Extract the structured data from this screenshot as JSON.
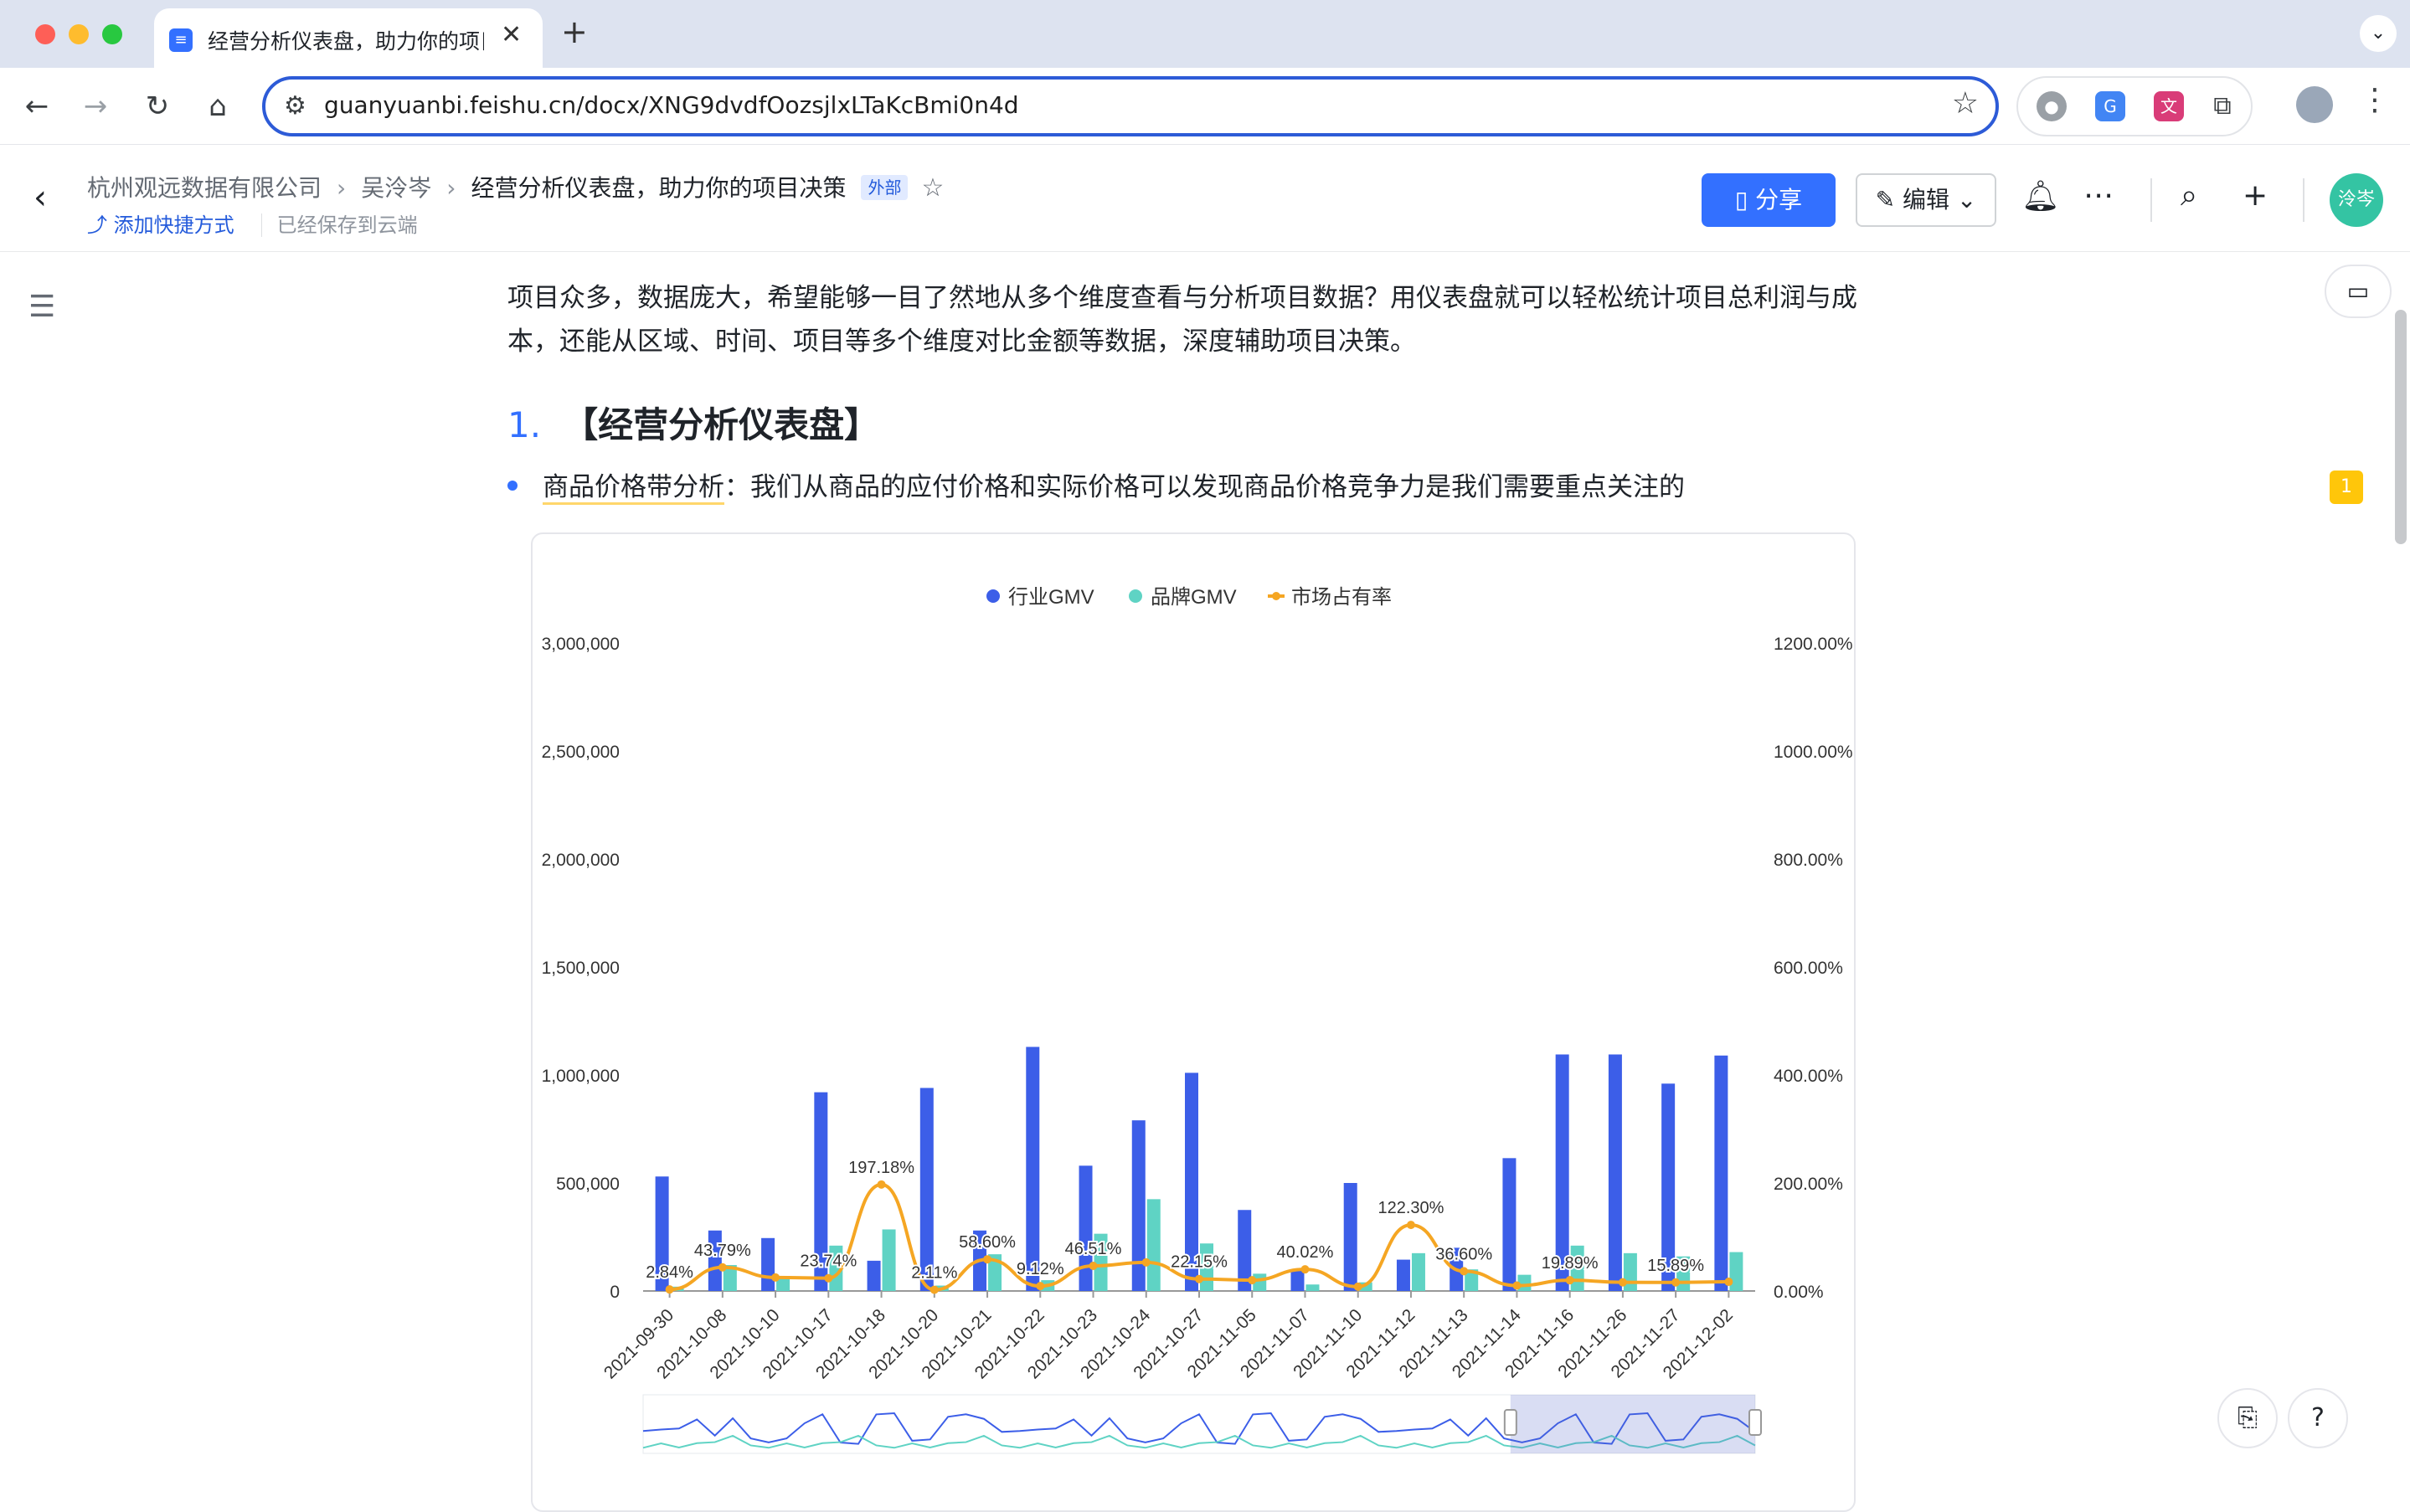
{
  "browser": {
    "tab_title": "经营分析仪表盘，助力你的项目决策",
    "url": "guanyuanbi.feishu.cn/docx/XNG9dvdfOozsjlxLTaKcBmi0n4d"
  },
  "header": {
    "breadcrumbs": [
      "杭州观远数据有限公司",
      "吴泠岑"
    ],
    "doc_title": "经营分析仪表盘，助力你的项目决策",
    "external_tag": "外部",
    "add_shortcut": "添加快捷方式",
    "saved_status": "已经保存到云端",
    "share_label": "分享",
    "edit_label": "编辑",
    "avatar_text": "泠岑"
  },
  "content": {
    "intro": "项目众多，数据庞大，希望能够一目了然地从多个维度查看与分析项目数据？用仪表盘就可以轻松统计项目总利润与成本，还能从区域、时间、项目等多个维度对比金额等数据，深度辅助项目决策。",
    "h1_number": "1.",
    "h1_text": "【经营分析仪表盘】",
    "bullet_key": "商品价格带分析",
    "bullet_text": "：我们从商品的应付价格和实际价格可以发现商品价格竞争力是我们需要重点关注的"
  },
  "sidebar": {
    "comment_count": "1"
  },
  "colors": {
    "industry": "#3c5ee8",
    "brand": "#5fd3c4",
    "share": "#f5a623",
    "accent": "#3370ff"
  },
  "chart_data": {
    "type": "bar",
    "categories": [
      "2021-09-30",
      "2021-10-08",
      "2021-10-10",
      "2021-10-17",
      "2021-10-18",
      "2021-10-20",
      "2021-10-21",
      "2021-10-22",
      "2021-10-23",
      "2021-10-24",
      "2021-10-27",
      "2021-11-05",
      "2021-11-07",
      "2021-11-10",
      "2021-11-12",
      "2021-11-13",
      "2021-11-14",
      "2021-11-16",
      "2021-11-26",
      "2021-11-27",
      "2021-12-02"
    ],
    "series": [
      {
        "name": "行业GMV",
        "type": "bar",
        "axis": "left",
        "values": [
          530000,
          280000,
          245000,
          920000,
          140000,
          940000,
          280000,
          1130000,
          580000,
          790000,
          1010000,
          375000,
          95000,
          500000,
          145000,
          200000,
          615000,
          1095000,
          1095000,
          960000,
          1090000
        ]
      },
      {
        "name": "品牌GMV",
        "type": "bar",
        "axis": "left",
        "values": [
          20000,
          120000,
          65000,
          210000,
          285000,
          25000,
          170000,
          50000,
          265000,
          425000,
          220000,
          80000,
          30000,
          40000,
          175000,
          100000,
          75000,
          210000,
          175000,
          160000,
          180000
        ]
      },
      {
        "name": "市场占有率",
        "type": "line",
        "axis": "right",
        "values": [
          2.84,
          43.79,
          25.0,
          23.74,
          197.18,
          2.11,
          58.6,
          9.12,
          46.51,
          53.0,
          22.15,
          20.0,
          40.02,
          8.0,
          122.3,
          36.6,
          10.0,
          19.89,
          16.0,
          15.89,
          17.0
        ]
      }
    ],
    "data_labels": [
      {
        "index": 0,
        "text": "2.84%"
      },
      {
        "index": 1,
        "text": "43.79%"
      },
      {
        "index": 3,
        "text": "23.74%"
      },
      {
        "index": 4,
        "text": "197.18%"
      },
      {
        "index": 5,
        "text": "2.11%"
      },
      {
        "index": 6,
        "text": "58.60%"
      },
      {
        "index": 7,
        "text": "9.12%"
      },
      {
        "index": 8,
        "text": "46.51%"
      },
      {
        "index": 10,
        "text": "22.15%"
      },
      {
        "index": 12,
        "text": "40.02%"
      },
      {
        "index": 14,
        "text": "122.30%"
      },
      {
        "index": 15,
        "text": "36.60%"
      },
      {
        "index": 17,
        "text": "19.89%"
      },
      {
        "index": 19,
        "text": "15.89%"
      }
    ],
    "y_left_ticks": [
      "0",
      "500,000",
      "1,000,000",
      "1,500,000",
      "2,000,000",
      "2,500,000",
      "3,000,000"
    ],
    "y_right_ticks": [
      "0.00%",
      "200.00%",
      "400.00%",
      "600.00%",
      "800.00%",
      "1000.00%",
      "1200.00%"
    ],
    "ylim_left": [
      0,
      3000000
    ],
    "ylim_right": [
      0,
      1200
    ],
    "legend_position": "top",
    "grid": false,
    "slider": {
      "start": 0.78,
      "end": 1.0
    }
  }
}
